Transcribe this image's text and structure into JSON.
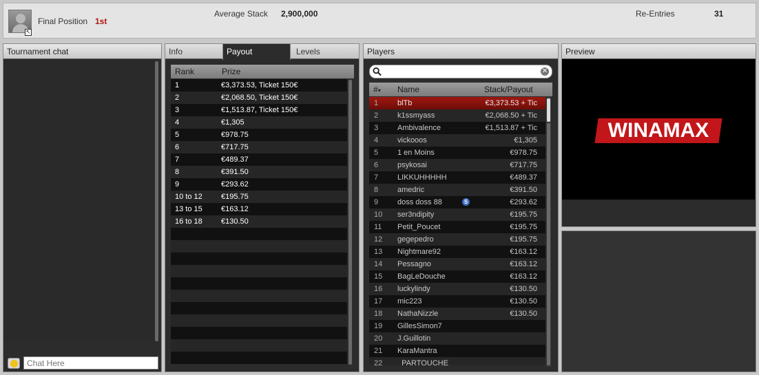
{
  "topbar": {
    "final_position_label": "Final Position",
    "final_position_value": "1st",
    "average_stack_label": "Average Stack",
    "average_stack_value": "2,900,000",
    "re_entries_label": "Re-Entries",
    "re_entries_value": "31"
  },
  "chat": {
    "title": "Tournament chat",
    "placeholder": "Chat Here"
  },
  "tabs": [
    {
      "label": "Info",
      "active": false
    },
    {
      "label": "Payout",
      "active": true
    },
    {
      "label": "Levels",
      "active": false
    }
  ],
  "payout": {
    "rank_header": "Rank",
    "prize_header": "Prize",
    "rows": [
      {
        "rank": "1",
        "prize": "€3,373.53, Ticket 150€"
      },
      {
        "rank": "2",
        "prize": "€2,068.50, Ticket 150€"
      },
      {
        "rank": "3",
        "prize": "€1,513.87, Ticket 150€"
      },
      {
        "rank": "4",
        "prize": "€1,305"
      },
      {
        "rank": "5",
        "prize": "€978.75"
      },
      {
        "rank": "6",
        "prize": "€717.75"
      },
      {
        "rank": "7",
        "prize": "€489.37"
      },
      {
        "rank": "8",
        "prize": "€391.50"
      },
      {
        "rank": "9",
        "prize": "€293.62"
      },
      {
        "rank": "10 to 12",
        "prize": "€195.75"
      },
      {
        "rank": "13 to 15",
        "prize": "€163.12"
      },
      {
        "rank": "16 to 18",
        "prize": "€130.50"
      },
      {
        "rank": "",
        "prize": ""
      },
      {
        "rank": "",
        "prize": ""
      },
      {
        "rank": "",
        "prize": ""
      },
      {
        "rank": "",
        "prize": ""
      },
      {
        "rank": "",
        "prize": ""
      },
      {
        "rank": "",
        "prize": ""
      },
      {
        "rank": "",
        "prize": ""
      },
      {
        "rank": "",
        "prize": ""
      },
      {
        "rank": "",
        "prize": ""
      },
      {
        "rank": "",
        "prize": ""
      },
      {
        "rank": "",
        "prize": ""
      }
    ]
  },
  "players": {
    "title": "Players",
    "num_header": "#",
    "name_header": "Name",
    "stack_header": "Stack/Payout",
    "rows": [
      {
        "num": "1",
        "name": "blTb",
        "stack": "€3,373.53 +  Tic",
        "selected": true
      },
      {
        "num": "2",
        "name": "k1ssmyass",
        "stack": "€2,068.50 +  Tic"
      },
      {
        "num": "3",
        "name": "Ambivalence",
        "stack": "€1,513.87 +  Tic"
      },
      {
        "num": "4",
        "name": "vickooos",
        "stack": "€1,305"
      },
      {
        "num": "5",
        "name": "1 en Moins",
        "stack": "€978.75"
      },
      {
        "num": "6",
        "name": "psykosai",
        "stack": "€717.75"
      },
      {
        "num": "7",
        "name": "LIKKUHHHHH",
        "stack": "€489.37"
      },
      {
        "num": "8",
        "name": "amedric",
        "stack": "€391.50"
      },
      {
        "num": "9",
        "name": "doss doss 88",
        "stack": "€293.62",
        "badge": "S"
      },
      {
        "num": "10",
        "name": "ser3ndipity",
        "stack": "€195.75"
      },
      {
        "num": "11",
        "name": "Petit_Poucet",
        "stack": "€195.75"
      },
      {
        "num": "12",
        "name": "gegepedro",
        "stack": "€195.75"
      },
      {
        "num": "13",
        "name": "Nightmare92",
        "stack": "€163.12"
      },
      {
        "num": "14",
        "name": "Pessagno",
        "stack": "€163.12"
      },
      {
        "num": "15",
        "name": "BagLeDouche",
        "stack": "€163.12"
      },
      {
        "num": "16",
        "name": "luckylindy",
        "stack": "€130.50"
      },
      {
        "num": "17",
        "name": "mic223",
        "stack": "€130.50"
      },
      {
        "num": "18",
        "name": "NathaNizzle",
        "stack": "€130.50"
      },
      {
        "num": "19",
        "name": "GillesSimon7",
        "stack": ""
      },
      {
        "num": "20",
        "name": "J.Guillotin",
        "stack": ""
      },
      {
        "num": "21",
        "name": "KaraMantra",
        "stack": ""
      },
      {
        "num": "22",
        "name": "_PARTOUCHE",
        "stack": ""
      }
    ]
  },
  "preview": {
    "title": "Preview",
    "logo_text": "WINAMAX"
  },
  "icons": {
    "search": "search-icon",
    "clear": "clear-icon",
    "smiley": "smiley-icon",
    "sort": "sort-arrow-icon"
  }
}
